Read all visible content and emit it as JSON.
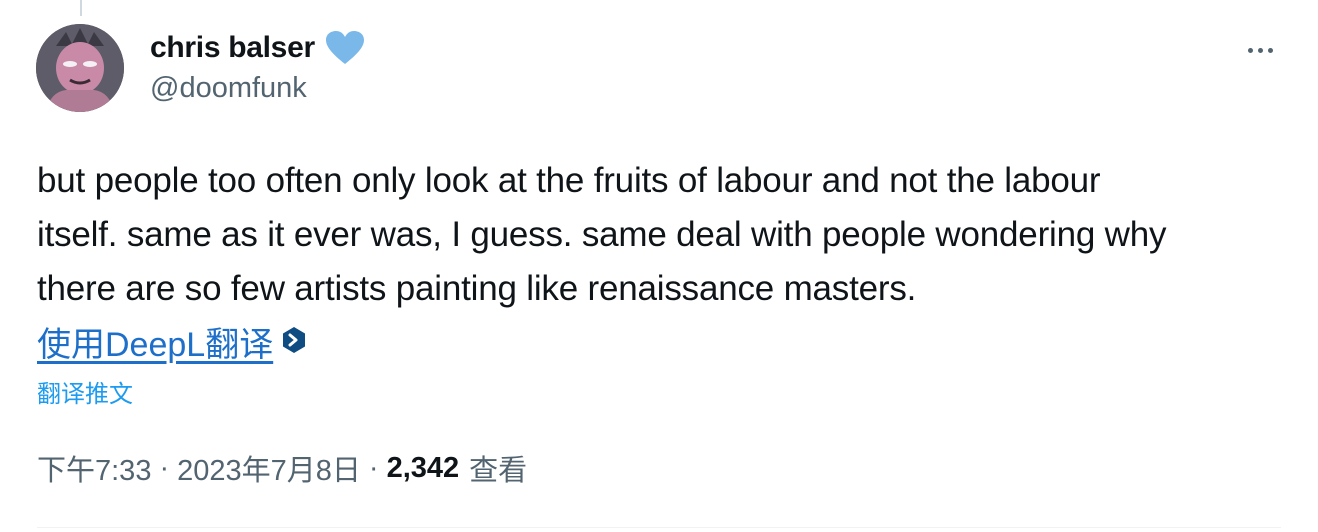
{
  "author": {
    "display_name": "chris balser",
    "handle": "@doomfunk"
  },
  "tweet": {
    "lines": [
      "but people too often only look at the fruits of labour and not the labour",
      "itself. same as it ever was, I guess. same deal with people wondering why",
      "there are so few artists painting like renaissance masters."
    ]
  },
  "translation": {
    "deepl_label": "使用DeepL翻译",
    "translate_post_label": "翻译推文"
  },
  "meta": {
    "time": "下午7:33",
    "separator": "·",
    "date": "2023年7月8日",
    "views_count": "2,342",
    "views_label": "查看"
  },
  "icons": {
    "verified": "heart-icon",
    "more": "more-icon",
    "deepl": "deepl-icon"
  },
  "colors": {
    "heart": "#7ab8ea",
    "link": "#1d6fc9",
    "accent": "#1d9bf0",
    "secondary_text": "#536471"
  }
}
